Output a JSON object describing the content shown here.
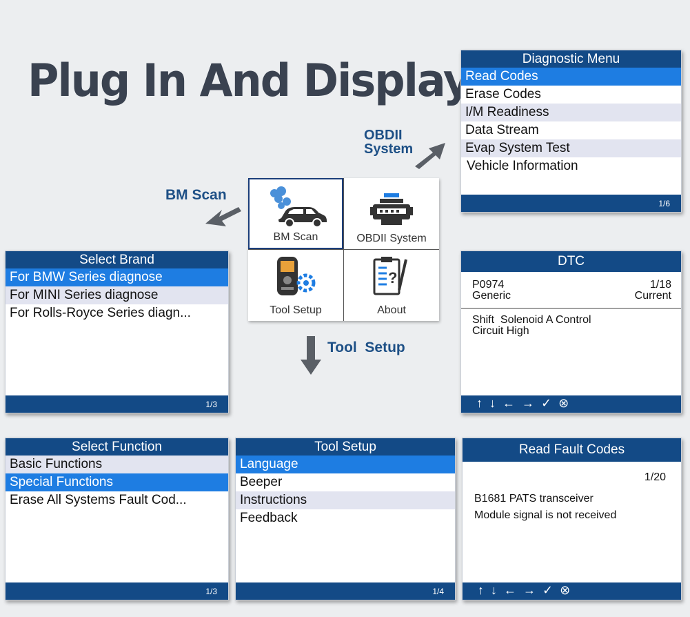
{
  "headline": "Plug In And Display:",
  "labels": {
    "obdii": [
      "OBDII",
      "System"
    ],
    "bm_scan": "BM Scan",
    "tool_setup": "Tool  Setup"
  },
  "menu": {
    "tiles": [
      {
        "label": "BM Scan",
        "icon": "car-engine-smoke-icon",
        "selected": true
      },
      {
        "label": "OBDII System",
        "icon": "engine-icon",
        "selected": false
      },
      {
        "label": "Tool Setup",
        "icon": "scanner-gear-icon",
        "selected": false
      },
      {
        "label": "About",
        "icon": "clipboard-question-icon",
        "selected": false
      }
    ]
  },
  "diagnostic_menu": {
    "title": "Diagnostic Menu",
    "items": [
      "Read Codes",
      "Erase Codes",
      "I/M Readiness",
      "Data Stream",
      "Evap System Test",
      "Vehicle Information"
    ],
    "page": "1/6"
  },
  "select_brand": {
    "title": "Select Brand",
    "items": [
      "For BMW Series diagnose",
      "For MINI Series diagnose",
      "For Rolls-Royce Series diagn..."
    ],
    "page": "1/3"
  },
  "dtc": {
    "title": "DTC",
    "code": "P0974",
    "type": "Generic",
    "index": "1/18",
    "status": "Current",
    "description_lines": [
      "Shift  Solenoid A Control",
      "Circuit High"
    ],
    "nav_icons": "↑↓←→✓⊗"
  },
  "select_function": {
    "title": "Select Function",
    "items": [
      "Basic Functions",
      "Special Functions",
      "Erase All Systems Fault Cod..."
    ],
    "page": "1/3"
  },
  "tool_setup_screen": {
    "title": "Tool Setup",
    "items": [
      "Language",
      "Beeper",
      "Instructions",
      "Feedback"
    ],
    "page": "1/4"
  },
  "read_fault_codes": {
    "title": "Read Fault Codes",
    "index": "1/20",
    "lines": [
      "B1681 PATS transceiver",
      "Module signal is not received"
    ],
    "nav_icons": "↑↓←→✓⊗"
  },
  "colors": {
    "header": "#134a86",
    "selected": "#1e7de2",
    "alt_row": "#e2e4f0",
    "label": "#1e5086"
  }
}
